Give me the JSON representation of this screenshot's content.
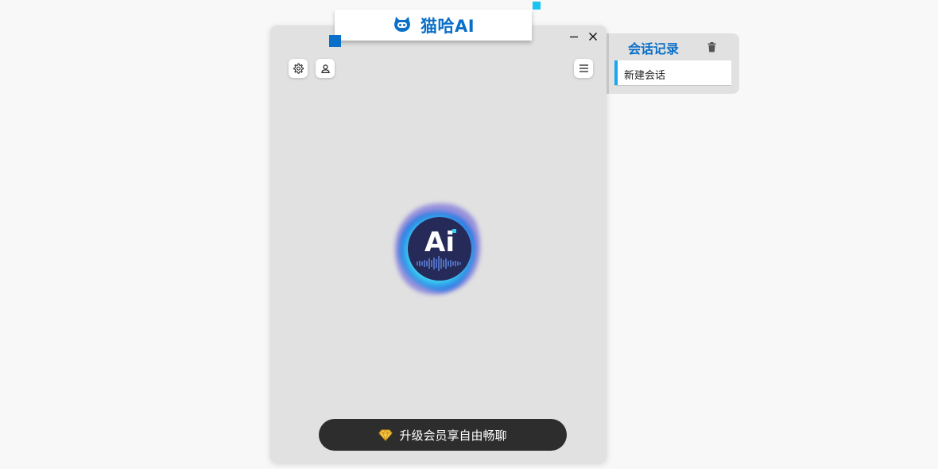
{
  "app": {
    "title": "猫哈AI"
  },
  "toolbar": {
    "settings_icon": "gear-icon",
    "user_icon": "user-icon",
    "menu_icon": "menu-icon"
  },
  "orb": {
    "text": "Ai"
  },
  "upgrade": {
    "label": "升级会员享自由畅聊",
    "icon": "diamond-icon"
  },
  "history": {
    "title": "会话记录",
    "items": [
      {
        "label": "新建会话",
        "active": true
      }
    ]
  },
  "colors": {
    "brand": "#0a6fc8",
    "accent": "#18c4f2",
    "window_bg": "#e1e1e1",
    "button_dark": "#2d2d2d"
  }
}
